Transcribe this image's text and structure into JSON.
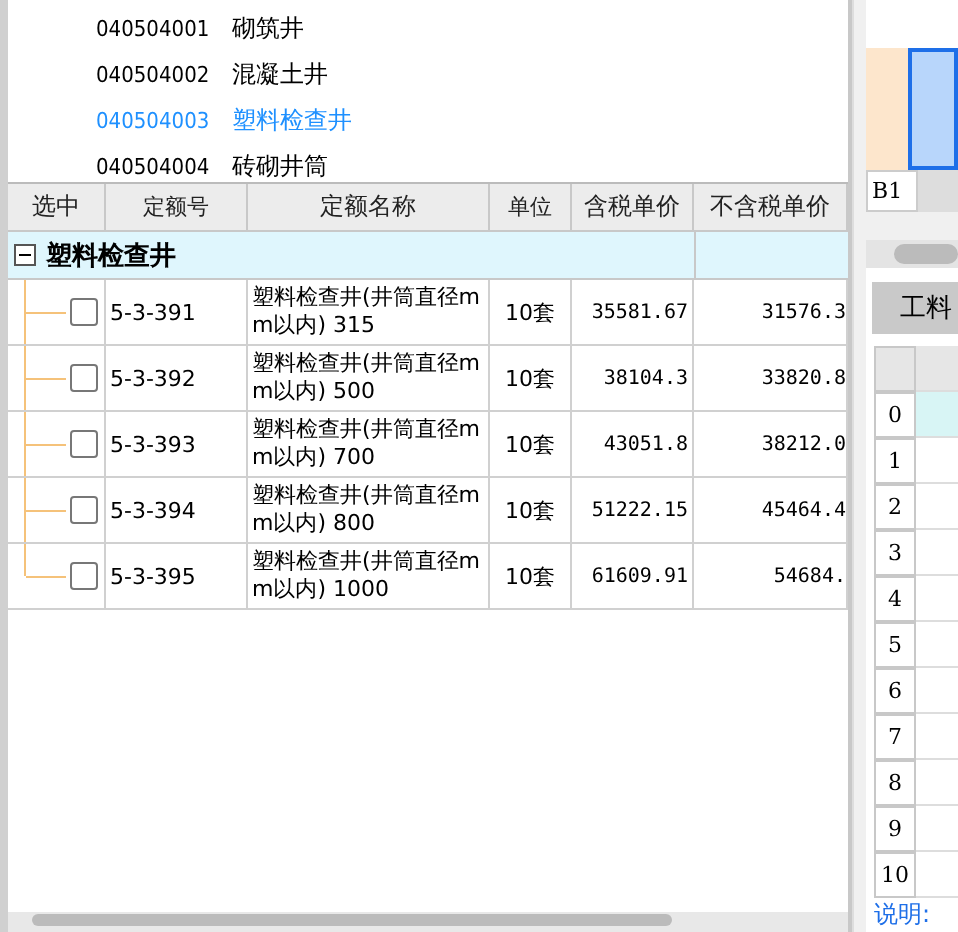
{
  "category_list": [
    {
      "code": "040504001",
      "name": "砌筑井",
      "selected": false
    },
    {
      "code": "040504002",
      "name": "混凝土井",
      "selected": false
    },
    {
      "code": "040504003",
      "name": "塑料检查井",
      "selected": true
    },
    {
      "code": "040504004",
      "name": "砖砌井筒",
      "selected": false
    }
  ],
  "quota_table": {
    "columns": [
      "选中",
      "定额号",
      "定额名称",
      "单位",
      "含税单价",
      "不含税单价"
    ],
    "group": {
      "name": "塑料检查井",
      "expanded": true
    },
    "rows": [
      {
        "checked": false,
        "code": "5-3-391",
        "name": "塑料检查井(井筒直径mm以内) 315",
        "unit": "10套",
        "price_tax": "35581.67",
        "price_notax": "31576.3"
      },
      {
        "checked": false,
        "code": "5-3-392",
        "name": "塑料检查井(井筒直径mm以内) 500",
        "unit": "10套",
        "price_tax": "38104.3",
        "price_notax": "33820.8"
      },
      {
        "checked": false,
        "code": "5-3-393",
        "name": "塑料检查井(井筒直径mm以内) 700",
        "unit": "10套",
        "price_tax": "43051.8",
        "price_notax": "38212.0"
      },
      {
        "checked": false,
        "code": "5-3-394",
        "name": "塑料检查井(井筒直径mm以内) 800",
        "unit": "10套",
        "price_tax": "51222.15",
        "price_notax": "45464.4"
      },
      {
        "checked": false,
        "code": "5-3-395",
        "name": "塑料检查井(井筒直径mm以内) 1000",
        "unit": "10套",
        "price_tax": "61609.91",
        "price_notax": "54684."
      }
    ]
  },
  "side_sheet": {
    "cell_ref": "B1",
    "tab": "工料",
    "row_numbers": [
      "0",
      "1",
      "2",
      "3",
      "4",
      "5",
      "6",
      "7",
      "8",
      "9",
      "10"
    ],
    "note": "说明:"
  }
}
